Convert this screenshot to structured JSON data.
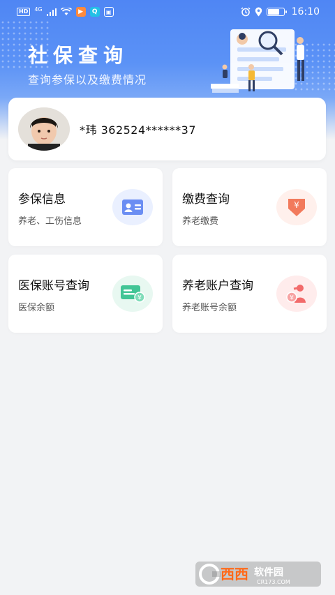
{
  "status_bar": {
    "network_hd": "HD",
    "network_type": "4G",
    "time": "16:10",
    "battery_level": 0.8
  },
  "header": {
    "title": "社保查询",
    "subtitle": "查询参保以及缴费情况"
  },
  "user": {
    "id_text": "*玮 362524******37"
  },
  "tiles": [
    {
      "title": "参保信息",
      "subtitle": "养老、工伤信息",
      "icon": "id-card-icon",
      "color": "#5b7ef0",
      "bg": "#eaf0ff"
    },
    {
      "title": "缴费查询",
      "subtitle": "养老缴费",
      "icon": "yuan-payment-icon",
      "color": "#f26b4f",
      "bg": "#fff0ec"
    },
    {
      "title": "医保账号查询",
      "subtitle": "医保余额",
      "icon": "medical-card-icon",
      "color": "#39c18f",
      "bg": "#e8f8f1"
    },
    {
      "title": "养老账户查询",
      "subtitle": "养老账号余额",
      "icon": "pension-account-icon",
      "color": "#f05a5a",
      "bg": "#ffecec"
    }
  ],
  "watermark": {
    "brand": "西西",
    "suffix": "软件园",
    "domain": "CR173.COM"
  },
  "colors": {
    "header_blue": "#4f86f4",
    "page_bg": "#f2f3f5"
  }
}
